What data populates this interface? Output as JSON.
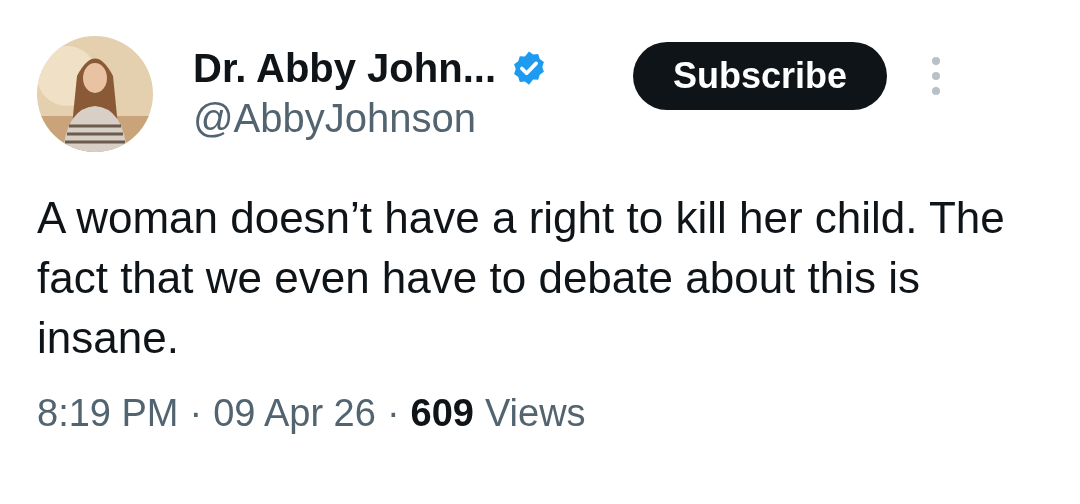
{
  "author": {
    "name": "Dr. Abby John...",
    "handle": "@AbbyJohnson",
    "verified": true
  },
  "subscribe_button": {
    "label": "Subscribe"
  },
  "post": {
    "text": "A woman doesn’t have a right to kill her child. The fact that we even have to debate about this is insane."
  },
  "meta": {
    "time": "8:19 PM",
    "separator": "·",
    "date": "09 Apr 26",
    "views_count": "609",
    "views_label": "Views"
  }
}
